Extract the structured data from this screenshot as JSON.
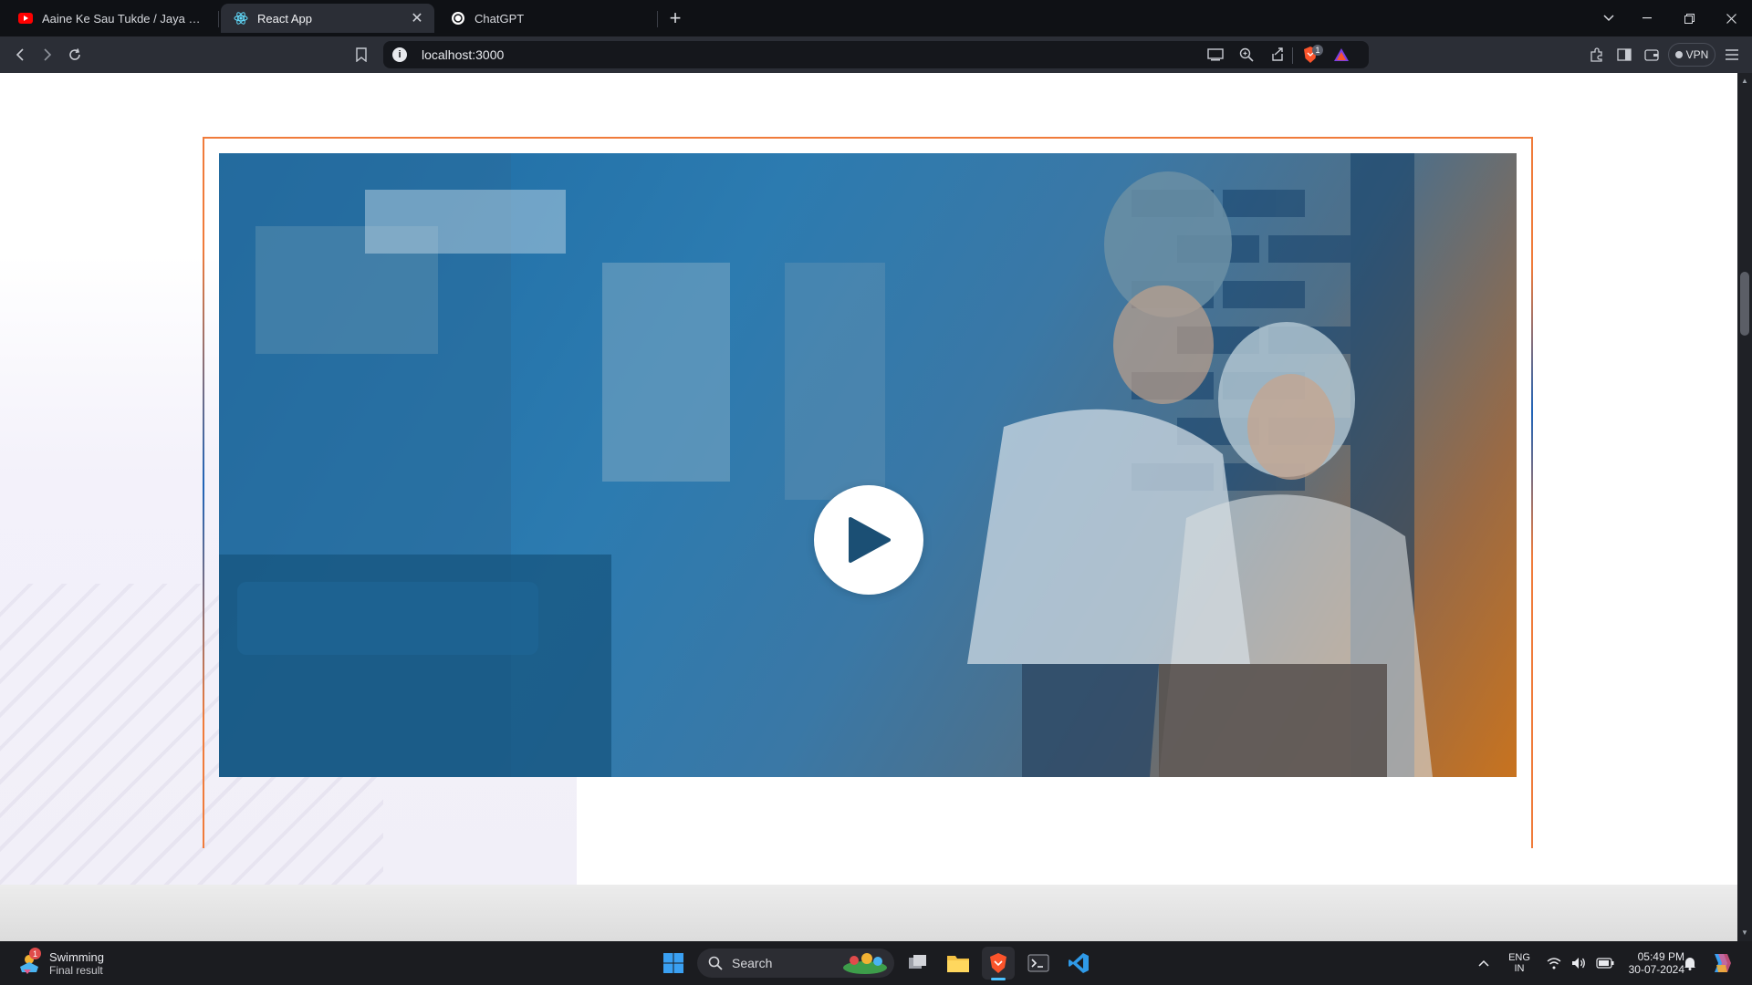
{
  "browser": {
    "tabs": [
      {
        "label": "Aaine Ke Sau Tukde / Jaya Parda / Ji",
        "icon": "youtube-icon",
        "active": false
      },
      {
        "label": "React App",
        "icon": "react-icon",
        "active": true
      },
      {
        "label": "ChatGPT",
        "icon": "chatgpt-icon",
        "active": false
      }
    ],
    "address": "localhost:3000",
    "vpn_label": "VPN",
    "brave_badge": "1"
  },
  "page": {
    "video": {
      "state": "paused",
      "play_icon": "play-icon"
    },
    "colors": {
      "frame": "#f07b3a",
      "overlay_blue": "#1c6aa3",
      "overlay_orange": "#c8731f"
    }
  },
  "taskbar": {
    "widget": {
      "title": "Swimming",
      "subtitle": "Final result",
      "badge": "1"
    },
    "search_label": "Search",
    "language": {
      "line1": "ENG",
      "line2": "IN"
    },
    "clock": {
      "time": "05:49 PM",
      "date": "30-07-2024"
    }
  }
}
